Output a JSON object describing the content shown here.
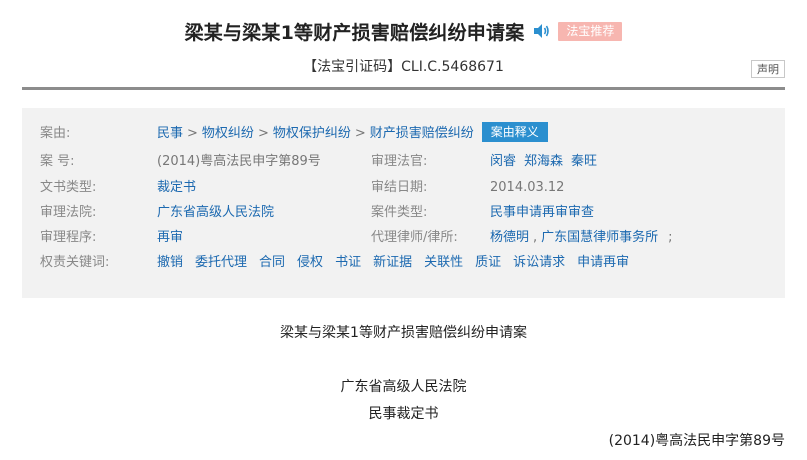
{
  "header": {
    "title": "梁某与梁某1等财产损害赔偿纠纷申请案",
    "badge": "法宝推荐",
    "cite_label": "【法宝引证码】",
    "cite_code": "CLI.C.5468671",
    "declare": "声明"
  },
  "info": {
    "case_cause_label": "案由:",
    "case_cause_path": [
      "民事",
      "物权纠纷",
      "物权保护纠纷",
      "财产损害赔偿纠纷"
    ],
    "case_cause_sep": ">",
    "case_cause_button": "案由释义",
    "case_no_label": "案 号:",
    "case_no": "(2014)粤高法民申字第89号",
    "judges_label": "审理法官:",
    "judges": [
      "闵睿",
      "郑海森",
      "秦旺"
    ],
    "doc_type_label": "文书类型:",
    "doc_type": "裁定书",
    "conclusion_date_label": "审结日期:",
    "conclusion_date": "2014.03.12",
    "court_label": "审理法院:",
    "court": "广东省高级人民法院",
    "case_type_label": "案件类型:",
    "case_type": "民事申请再审审查",
    "procedure_label": "审理程序:",
    "procedure": "再审",
    "lawyer_label": "代理律师/律所:",
    "lawyer": "杨德明",
    "law_firm": "广东国慧律师事务所",
    "lawyer_sep": ",",
    "law_firm_trailing": ";",
    "keywords_label": "权责关键词:",
    "keywords": [
      "撤销",
      "委托代理",
      "合同",
      "侵权",
      "书证",
      "新证据",
      "关联性",
      "质证",
      "诉讼请求",
      "申请再审"
    ]
  },
  "body": {
    "doc_title": "梁某与梁某1等财产损害赔偿纠纷申请案",
    "court_name": "广东省高级人民法院",
    "doc_kind": "民事裁定书",
    "case_no": "(2014)粤高法民申字第89号"
  }
}
